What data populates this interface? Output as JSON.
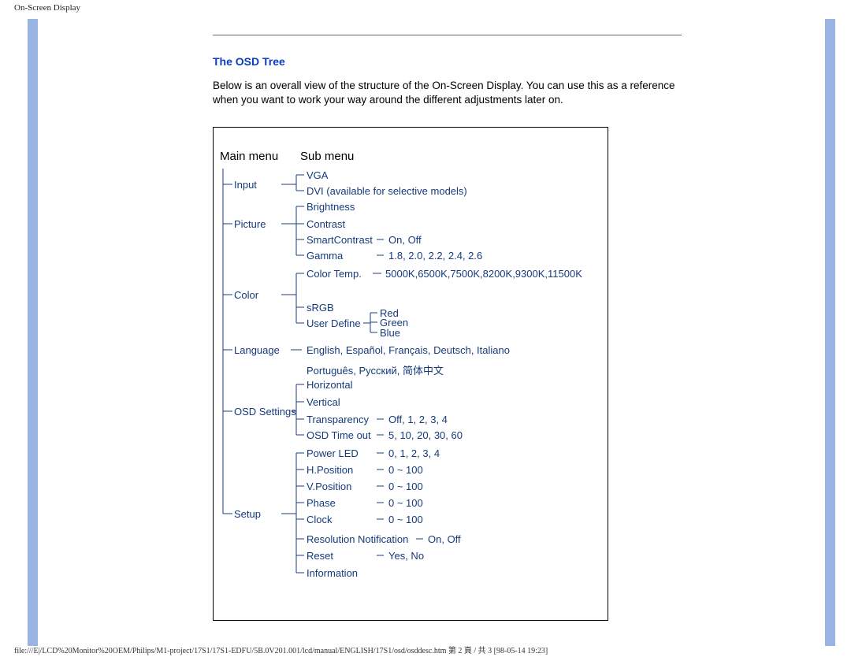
{
  "header": {
    "doc_title": "On-Screen Display"
  },
  "section": {
    "title": "The OSD Tree",
    "intro": "Below is an overall view of the structure of the On-Screen Display. You can use this as a reference when you want to work your way around the different adjustments later on."
  },
  "tree": {
    "main_header": "Main menu",
    "sub_header": "Sub menu",
    "main": {
      "input": "Input",
      "picture": "Picture",
      "color": "Color",
      "language": "Language",
      "osd_settings": "OSD Settings",
      "setup": "Setup"
    },
    "sub": {
      "vga": "VGA",
      "dvi": "DVI (available for selective models)",
      "brightness": "Brightness",
      "contrast": "Contrast",
      "smartcontrast": "SmartContrast",
      "smartcontrast_vals": "On, Off",
      "gamma": "Gamma",
      "gamma_vals": "1.8, 2.0, 2.2, 2.4, 2.6",
      "color_temp": "Color Temp.",
      "color_temp_vals": "5000K,6500K,7500K,8200K,9300K,11500K",
      "srgb": "sRGB",
      "user_define": "User Define",
      "red": "Red",
      "green": "Green",
      "blue": "Blue",
      "languages1": "English, Español, Français, Deutsch, Italiano",
      "languages2": "Português, Русский, 简体中文",
      "horizontal": "Horizontal",
      "vertical": "Vertical",
      "transparency": "Transparency",
      "transparency_vals": "Off, 1, 2, 3, 4",
      "osd_timeout": "OSD Time out",
      "osd_timeout_vals": "5, 10, 20, 30, 60",
      "power_led": "Power LED",
      "power_led_vals": "0, 1, 2, 3, 4",
      "hposition": "H.Position",
      "hposition_vals": "0 ~ 100",
      "vposition": "V.Position",
      "vposition_vals": "0 ~ 100",
      "phase": "Phase",
      "phase_vals": "0 ~ 100",
      "clock": "Clock",
      "clock_vals": "0 ~ 100",
      "resolution_notif": "Resolution Notification",
      "resolution_notif_vals": "On, Off",
      "reset": "Reset",
      "reset_vals": "Yes, No",
      "information": "Information"
    }
  },
  "footer": {
    "path": "file:///E|/LCD%20Monitor%20OEM/Philips/M1-project/17S1/17S1-EDFU/5B.0V201.001/lcd/manual/ENGLISH/17S1/osd/osddesc.htm 第 2 頁 / 共 3  [98-05-14 19:23]"
  }
}
